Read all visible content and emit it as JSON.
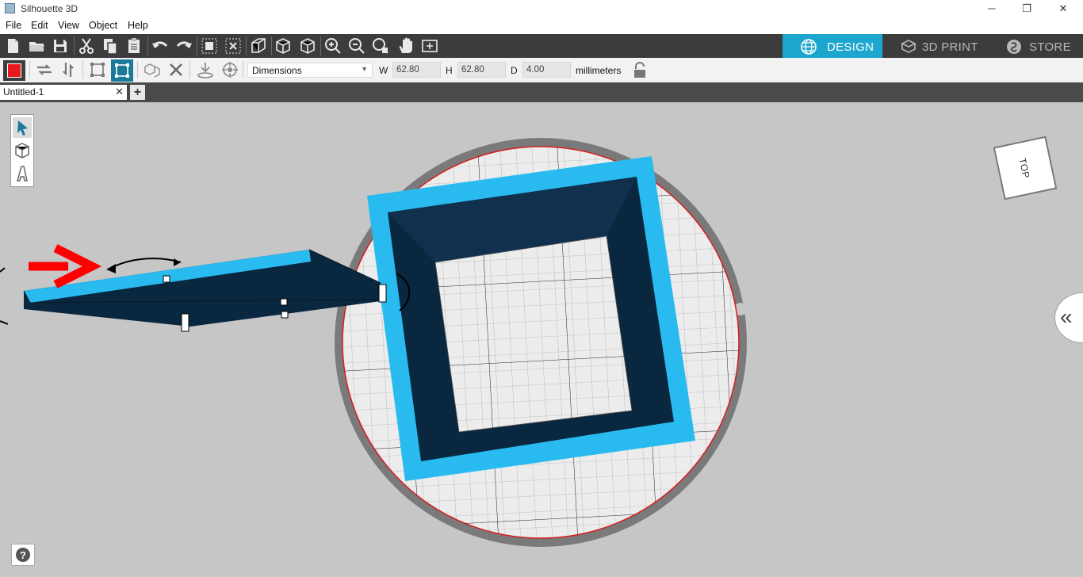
{
  "window": {
    "title": "Silhouette 3D",
    "minimize_glyph": "─",
    "maximize_glyph": "❐",
    "close_glyph": "✕"
  },
  "menu": [
    "File",
    "Edit",
    "View",
    "Object",
    "Help"
  ],
  "toolbar_main": {
    "icons": [
      "new-file-icon",
      "open-folder-icon",
      "save-icon",
      "cut-icon",
      "copy-icon",
      "paste-icon",
      "undo-icon",
      "redo-icon",
      "group-icon",
      "ungroup-icon",
      "perspective-icon",
      "box-view-icon",
      "box-view-alt-icon",
      "zoom-in-icon",
      "zoom-out-icon",
      "zoom-fit-icon",
      "pan-hand-icon",
      "fit-page-icon"
    ]
  },
  "mode_tabs": [
    {
      "label": "DESIGN",
      "icon": "globe-icon",
      "active": true
    },
    {
      "label": "3D PRINT",
      "icon": "print-3d-icon",
      "active": false
    },
    {
      "label": "STORE",
      "icon": "store-icon",
      "active": false
    }
  ],
  "toolbar_object": {
    "fill_color": "#e8191e",
    "dimension_mode": "Dimensions",
    "width_label": "W",
    "width_value": "62.80",
    "height_label": "H",
    "height_value": "62.80",
    "depth_label": "D",
    "depth_value": "4.00",
    "units": "millimeters"
  },
  "document_tab": {
    "label": "Untitled-1",
    "close_glyph": "✕",
    "add_glyph": "+"
  },
  "view_cube": {
    "label": "TOP"
  },
  "side_panel": {
    "glyph": "«"
  },
  "help": {
    "glyph": "?"
  },
  "colors": {
    "accent": "#1da7cf",
    "object_top": "#29bbf0",
    "object_side": "#0a2740",
    "bed_edge": "#7a7a7a",
    "bed_outline": "#d91c1c",
    "annotation_arrow": "#ff0000"
  }
}
